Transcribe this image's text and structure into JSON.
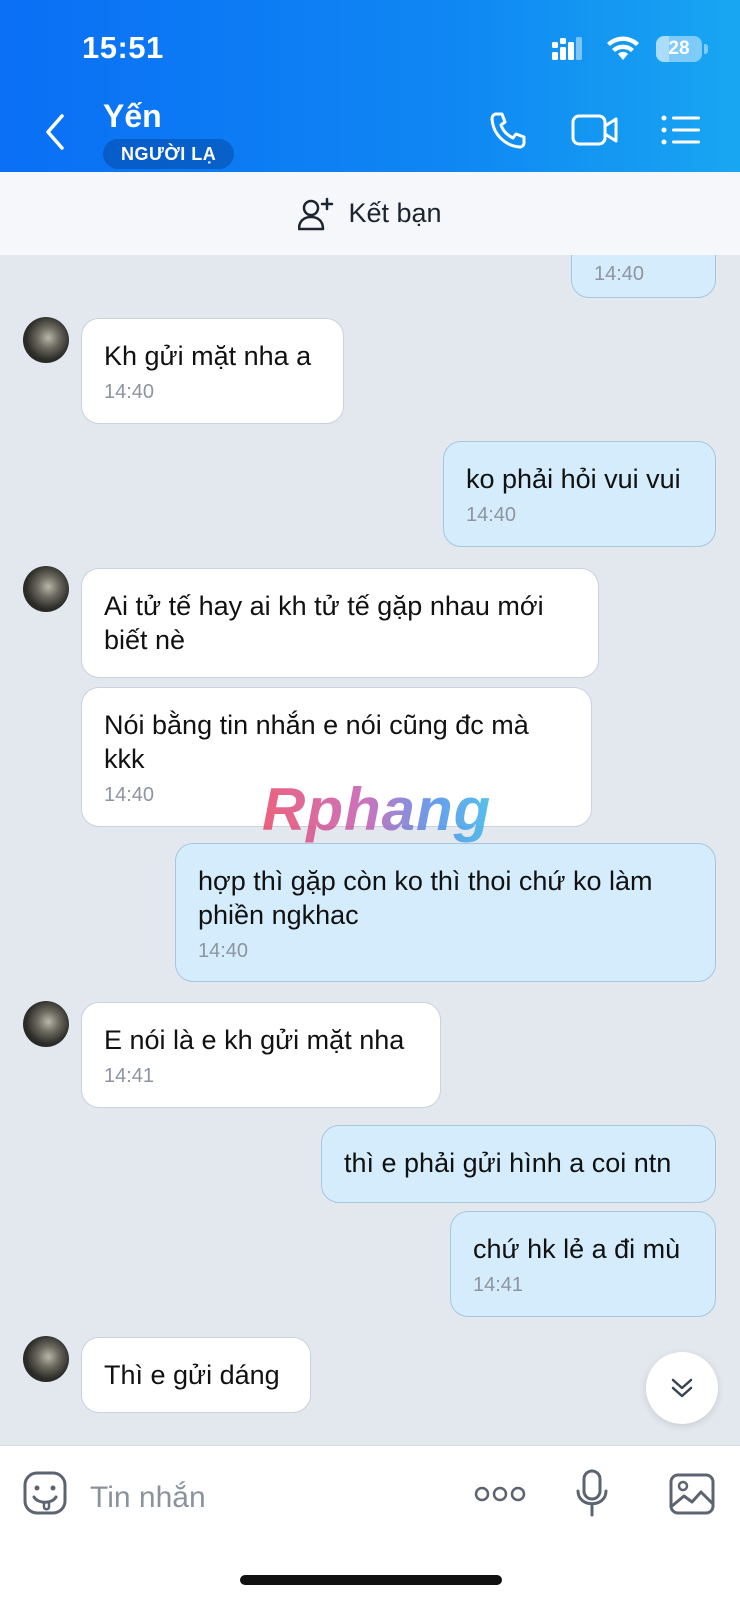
{
  "status_bar": {
    "time": "15:51",
    "battery": "28",
    "battery_level": 0.28
  },
  "header": {
    "contact_name": "Yến",
    "badge": "NGƯỜI LẠ",
    "icons": [
      "chevron-left-icon",
      "phone-icon",
      "video-camera-icon",
      "list-menu-icon"
    ]
  },
  "add_friend": {
    "label": "Kết bạn",
    "icon": "add-person-icon"
  },
  "messages": [
    {
      "side": "out",
      "text": "",
      "time": "14:40"
    },
    {
      "side": "in",
      "text": "Kh gửi mặt nha a",
      "time": "14:40"
    },
    {
      "side": "out",
      "text": "ko phải hỏi vui vui",
      "time": "14:40"
    },
    {
      "side": "in",
      "text": "Ai tử tế hay ai kh tử tế gặp nhau mới biết nè",
      "time": ""
    },
    {
      "side": "in",
      "text": "Nói bằng tin nhắn e nói cũng đc mà kkk",
      "time": "14:40"
    },
    {
      "side": "out",
      "text": "hợp thì gặp còn ko thì thoi chứ ko làm phiền ngkhac",
      "time": "14:40"
    },
    {
      "side": "in",
      "text": "E nói là e kh gửi mặt nha",
      "time": "14:41"
    },
    {
      "side": "out",
      "text": "thì e phải gửi hình a coi ntn",
      "time": ""
    },
    {
      "side": "out",
      "text": "chứ hk lẻ a đi mù",
      "time": "14:41"
    },
    {
      "side": "in",
      "text": "Thì e gửi dáng",
      "time": ""
    }
  ],
  "watermark": "Rphang",
  "input_bar": {
    "placeholder": "Tin nhắn"
  },
  "colors": {
    "header_start": "#0a6ff5",
    "header_end": "#18a6f2",
    "outgoing_bubble": "#d4ecfc",
    "chat_bg": "#e3e8ef"
  }
}
